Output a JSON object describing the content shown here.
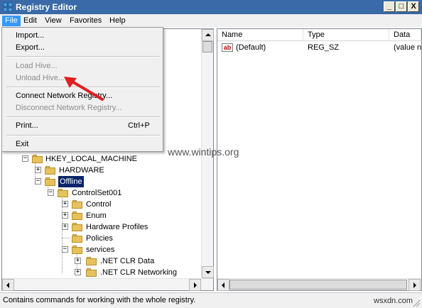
{
  "window": {
    "title": "Registry Editor",
    "minimize": "_",
    "maximize": "□",
    "close": "X"
  },
  "menubar": [
    "File",
    "Edit",
    "View",
    "Favorites",
    "Help"
  ],
  "file_menu": {
    "import": "Import...",
    "export": "Export...",
    "load_hive": "Load Hive...",
    "unload_hive": "Unload Hive...",
    "connect": "Connect Network Registry...",
    "disconnect": "Disconnect Network Registry...",
    "print": "Print...",
    "print_shortcut": "Ctrl+P",
    "exit": "Exit"
  },
  "tree": {
    "hklm": "HKEY_LOCAL_MACHINE",
    "hardware": "HARDWARE",
    "offline": "Offline",
    "controlset": "ControlSet001",
    "control": "Control",
    "enum": "Enum",
    "hw_profiles": "Hardware Profiles",
    "policies": "Policies",
    "services": "services",
    "clr_data": ".NET CLR Data",
    "clr_net": ".NET CLR Networking"
  },
  "list": {
    "col_name": "Name",
    "col_type": "Type",
    "col_data": "Data",
    "row_name": "(Default)",
    "row_type": "REG_SZ",
    "row_data": "(value n"
  },
  "status": "Contains commands for working with the whole registry.",
  "watermark1": "www.wintips.org",
  "watermark2": "wsxdn.com",
  "colors": {
    "titlebar": "#3a6aa8",
    "highlight": "#3399ff",
    "arrow": "#e02020"
  }
}
